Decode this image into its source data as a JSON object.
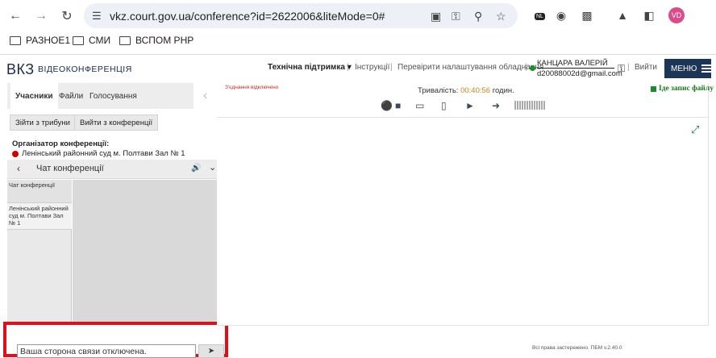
{
  "browser": {
    "url": "vkz.court.gov.ua/conference?id=2622006&liteMode=0#",
    "avatar_initials": "VD",
    "nl_badge": "NL",
    "bookmarks": [
      "РАЗНОЕ1",
      "СМИ",
      "ВСПОМ PHP"
    ],
    "icons": [
      "back-arrow-icon",
      "forward-arrow-icon",
      "reload-icon",
      "tune-icon",
      "camera-icon",
      "key-icon",
      "zoom-icon",
      "star-icon",
      "globe-icon",
      "planet-icon",
      "extensions-icon",
      "flask-icon",
      "sidepanel-icon"
    ]
  },
  "header": {
    "logo": "ВКЗ",
    "logo_sub": "ВІДЕОКОНФЕРЕНЦІЯ",
    "support": "Технічна підтримка ▾",
    "instructions": "Інструкції",
    "check_settings": "Перевірити налаштування обладнання",
    "user_name": "КАНЦАРА ВАЛЕРІЙ",
    "user_email": "d20088002d@gmail.com",
    "logout": "Вийти",
    "menu": "МЕНЮ",
    "separator": "|"
  },
  "left_panel": {
    "tabs": [
      "Учасники",
      "Файли",
      "Голосування"
    ],
    "btn_leave_tribune": "Зійти з трибуни",
    "btn_leave_conf": "Вийти з конференції",
    "organizer_label": "Організатор конференції:",
    "organizer_name": "Ленінський районний суд м. Полтави Зал № 1"
  },
  "chat": {
    "title": "Чат конференції",
    "list_header": "Чат конференції",
    "list_item": "Ленінський районний суд м. Полтави Зал № 1",
    "input_value": "Ваша сторона связи отключена."
  },
  "stage": {
    "connection_lost": "З'єднання відключено",
    "duration_label": "Тривалість:",
    "duration_time": "00:40:56",
    "duration_unit": "годин.",
    "recording": "Іде запис файлу",
    "controls": [
      "microphone-icon",
      "video-camera-icon",
      "screen-share-icon",
      "document-icon",
      "megaphone-icon",
      "exit-icon"
    ],
    "accent_color": "#c9861a"
  },
  "footer": {
    "text": "Всі права застережено. ПБМ v.2.40.0"
  },
  "colors": {
    "menu_bg": "#1d3557",
    "highlight_border": "#e0101b",
    "online_green": "#1a8c2e",
    "organizer_red": "#d00000"
  }
}
